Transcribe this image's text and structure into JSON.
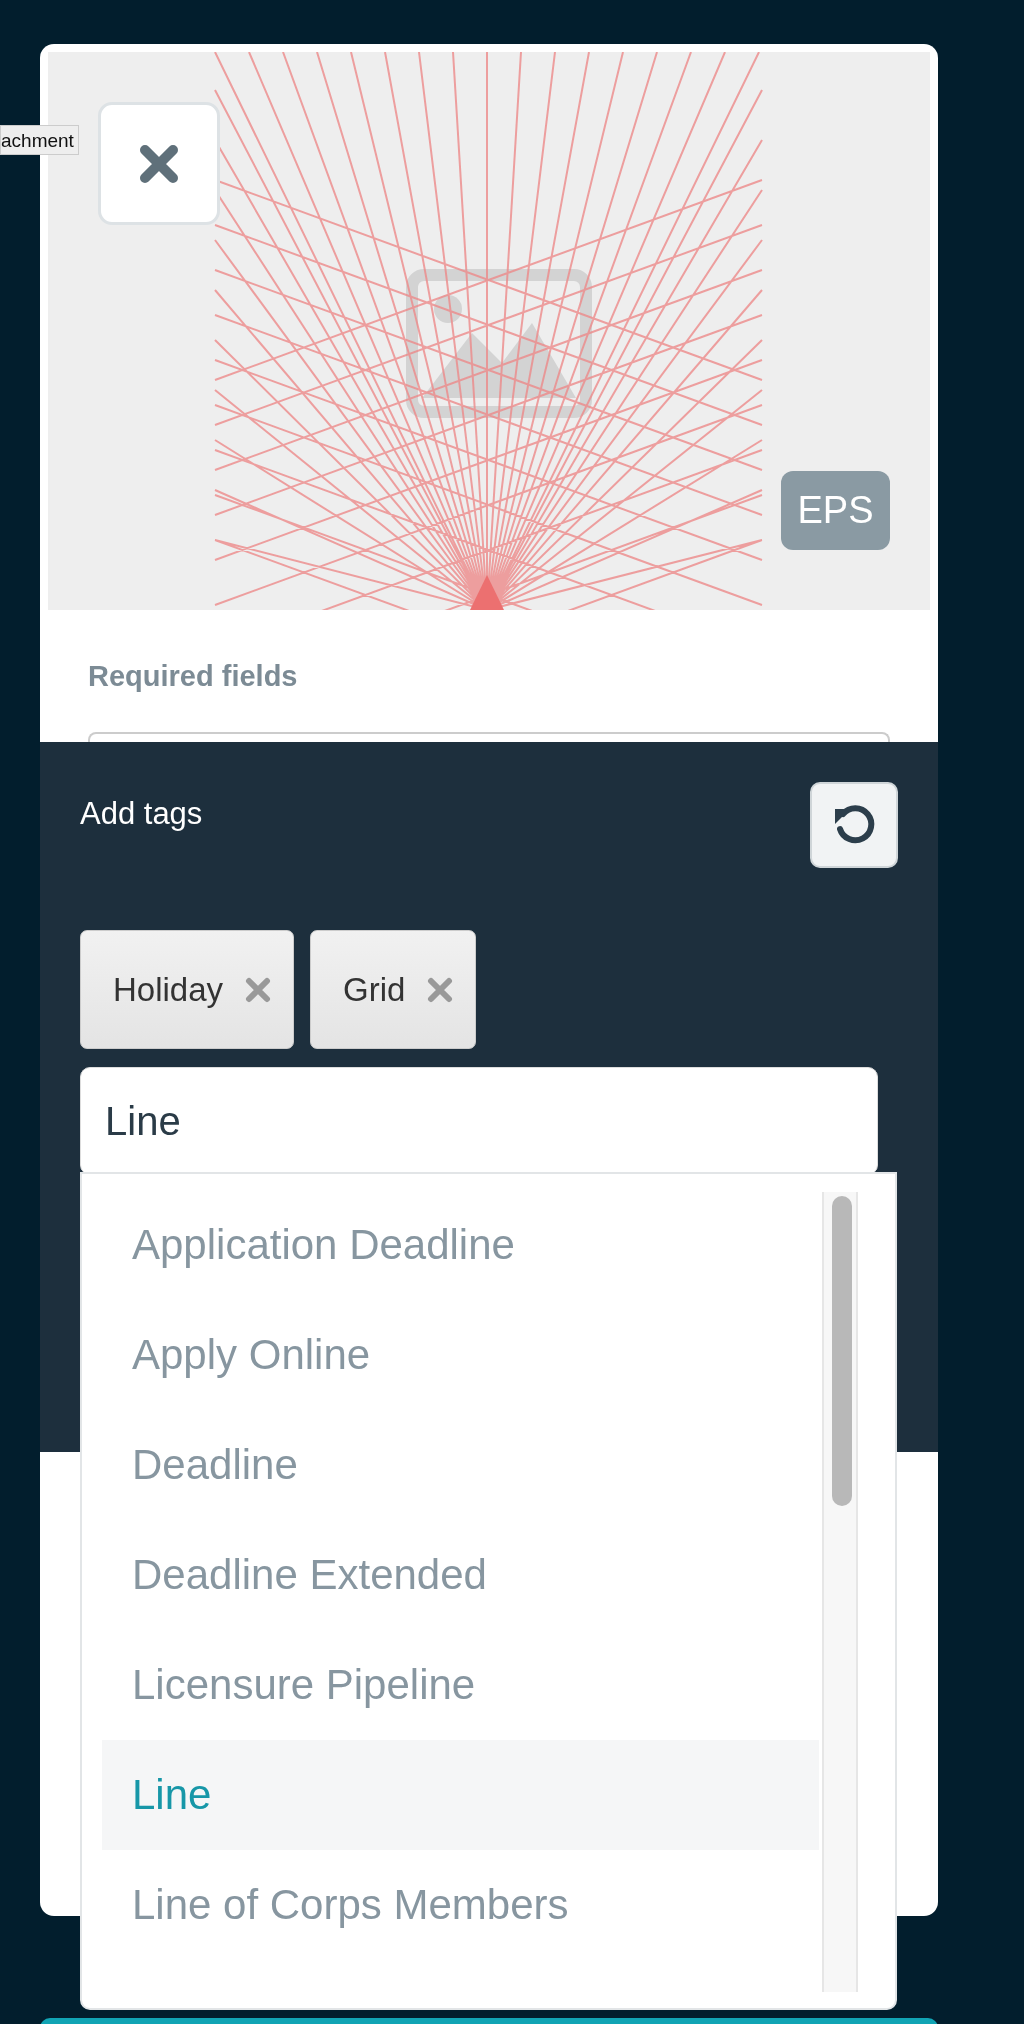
{
  "tooltip": {
    "text": "achment"
  },
  "attachment": {
    "format_badge": "EPS"
  },
  "required_fields": {
    "heading": "Required fields"
  },
  "tags_panel": {
    "title": "Add tags",
    "tags": [
      {
        "label": "Holiday"
      },
      {
        "label": "Grid"
      }
    ],
    "input": {
      "value": "Line"
    },
    "suggestions": [
      {
        "label": "Application Deadline",
        "selected": false
      },
      {
        "label": "Apply Online",
        "selected": false
      },
      {
        "label": "Deadline",
        "selected": false
      },
      {
        "label": "Deadline Extended",
        "selected": false
      },
      {
        "label": "Licensure Pipeline",
        "selected": false
      },
      {
        "label": "Line",
        "selected": true
      },
      {
        "label": "Line of Corps Members",
        "selected": false
      }
    ]
  }
}
